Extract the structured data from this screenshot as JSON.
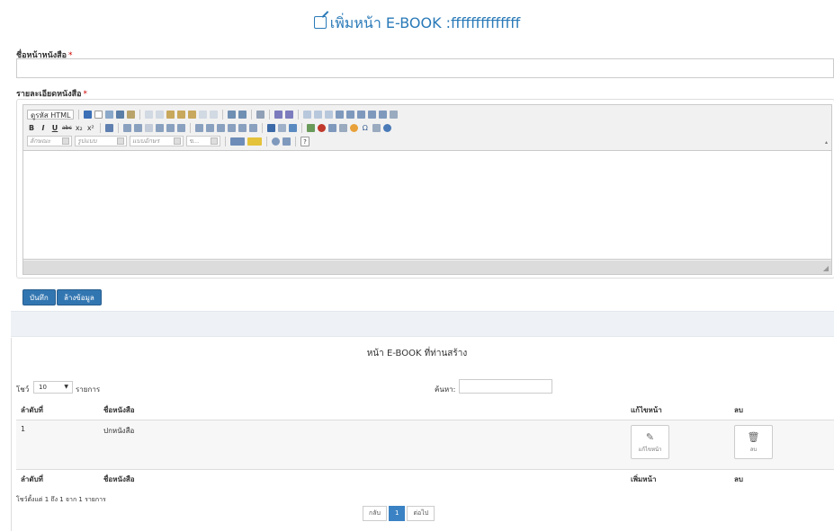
{
  "form": {
    "title": "เพิ่มหน้า E-BOOK :ffffffffffffff",
    "book_name_label": "ชื่อหน้าหนังสือ",
    "book_detail_label": "รายละเอียดหนังสือ",
    "required_mark": "*",
    "book_name_value": ""
  },
  "editor": {
    "source_label": "ดูรหัส HTML",
    "style_placeholder": "ลักษณะ",
    "format_placeholder": "รูปแบบ",
    "font_placeholder": "แบบอักษร",
    "size_placeholder": "ข...",
    "bold": "B",
    "italic": "I",
    "underline": "U",
    "strike": "abc",
    "subscript": "x₂",
    "superscript": "x²",
    "help": "?"
  },
  "buttons": {
    "save": "บันทึก",
    "clear": "ล้างข้อมูล"
  },
  "list": {
    "title": "หน้า E-BOOK ที่ท่านสร้าง",
    "show_label": "โชว์",
    "page_size": "10",
    "records_label": "รายการ",
    "search_label": "ค้นหา:",
    "search_value": "",
    "columns": [
      "ลำดับที่",
      "ชื่อหนังสือ",
      "แก้ไขหน้า",
      "ลบ"
    ],
    "footer_columns": [
      "ลำดับที่",
      "ชื่อหนังสือ",
      "เพิ่มหน้า",
      "ลบ"
    ],
    "rows": [
      {
        "no": "1",
        "name": "ปกหนังสือ",
        "edit_label": "แก้ไขหน้า",
        "delete_label": "ลบ"
      }
    ],
    "info": "โชว์ตั้งแต่ 1 ถึง 1 จาก 1 รายการ",
    "pager": {
      "prev": "กลับ",
      "current": "1",
      "next": "ต่อไป"
    }
  }
}
